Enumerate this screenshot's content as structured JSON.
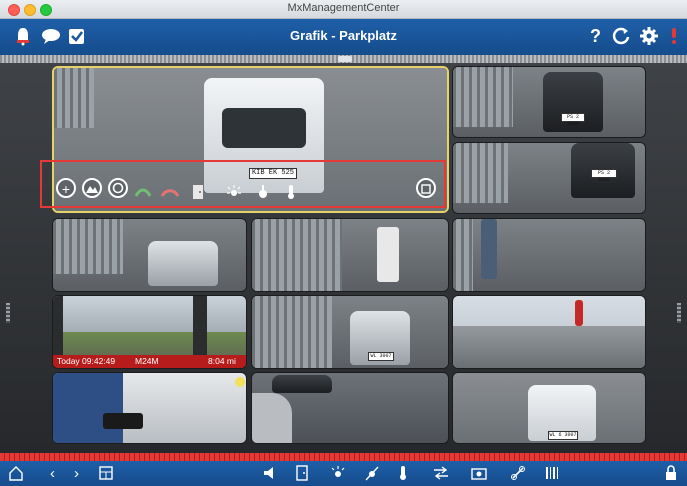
{
  "window": {
    "title": "MxManagementCenter"
  },
  "toolbar": {
    "title": "Grafik - Parkplatz",
    "help_label": "?",
    "icons": [
      "alarm-icon",
      "chat-icon",
      "checkbox-icon",
      "help-icon",
      "refresh-icon",
      "gear-icon",
      "notification-icon"
    ]
  },
  "cameras": {
    "main": {
      "plate": "KIB EK 525"
    },
    "cam2": {
      "plate": "PS 2 3006"
    },
    "cam3": {
      "plate": "PS 2 3006"
    },
    "cam8": {
      "plate": "WL 3007"
    },
    "cam12": {
      "plate": "WL 6 3007"
    },
    "recording": {
      "date": "Today 09:42:49",
      "quality": "M24M",
      "duration": "8:04 mi"
    }
  },
  "colors": {
    "toolbar_blue": "#1a569b",
    "highlight_red": "#e53935",
    "active_yellow": "#e6d26a"
  }
}
